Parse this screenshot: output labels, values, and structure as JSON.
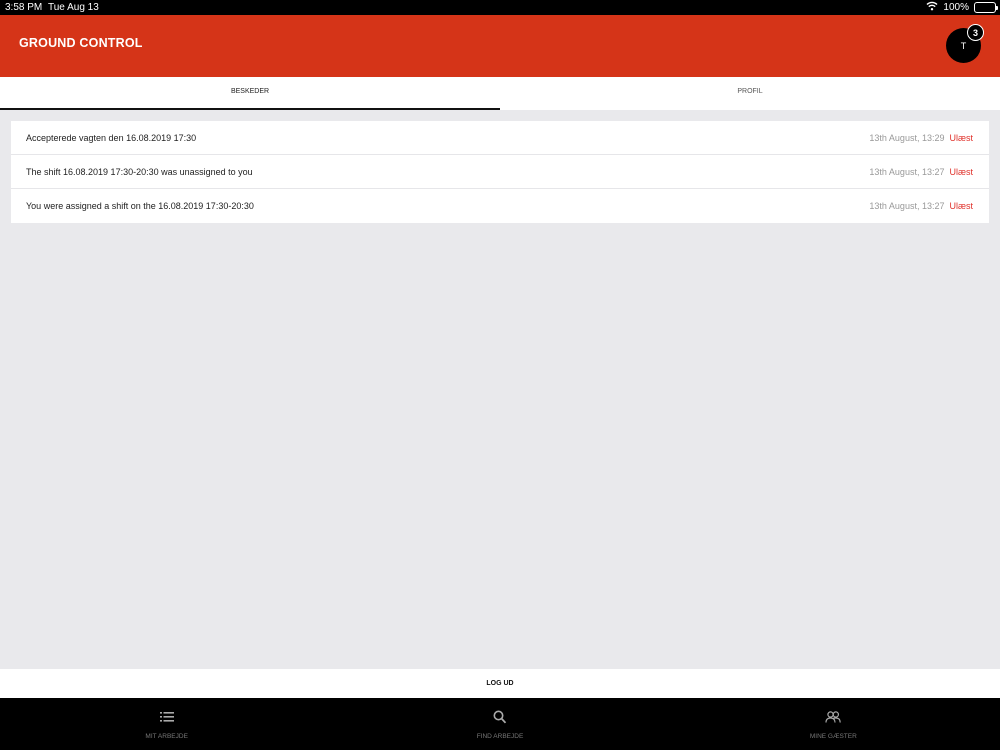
{
  "status_bar": {
    "time": "3:58 PM",
    "date": "Tue Aug 13",
    "battery": "100%"
  },
  "header": {
    "title": "GROUND CONTROL",
    "avatar_initial": "T",
    "badge_count": "3"
  },
  "tabs": [
    {
      "label": "BESKEDER",
      "active": true
    },
    {
      "label": "PROFIL",
      "active": false
    }
  ],
  "messages": [
    {
      "text": "Accepterede vagten den 16.08.2019 17:30",
      "time": "13th August, 13:29",
      "status": "Ulæst"
    },
    {
      "text": "The shift 16.08.2019 17:30-20:30 was unassigned to you",
      "time": "13th August, 13:27",
      "status": "Ulæst"
    },
    {
      "text": "You were assigned a shift on the 16.08.2019 17:30-20:30",
      "time": "13th August, 13:27",
      "status": "Ulæst"
    }
  ],
  "logout_label": "LOG UD",
  "bottom_nav": [
    {
      "label": "MIT ARBEJDE",
      "icon": "list-icon"
    },
    {
      "label": "FIND ARBEJDE",
      "icon": "search-icon"
    },
    {
      "label": "MINE GÆSTER",
      "icon": "users-icon"
    }
  ],
  "colors": {
    "brand": "#d53418",
    "unread": "#e0312a",
    "nav_bg": "#000000",
    "page_bg": "#e9e9ec"
  }
}
